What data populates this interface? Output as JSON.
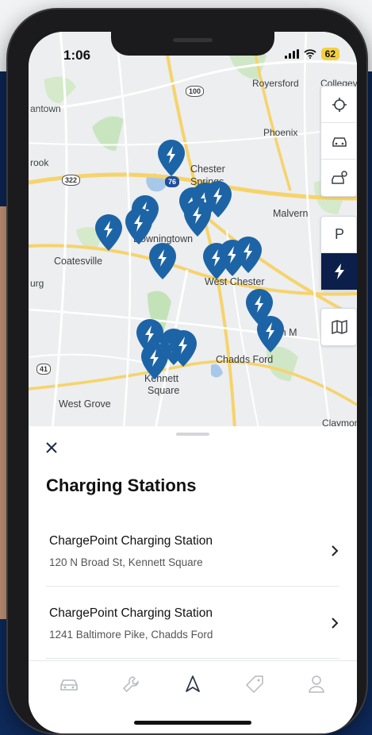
{
  "status_bar": {
    "time": "1:06",
    "battery": "62"
  },
  "map": {
    "labels": {
      "royersford": "Royersford",
      "collegeville": "Collegevi",
      "phoenix": "Phoenix",
      "antown": "antown",
      "rook": "rook",
      "chester": "Chester",
      "springs": "Springs",
      "malvern": "Malvern",
      "downingtown": "Downingtown",
      "coatesville": "Coatesville",
      "urg": "urg",
      "west_chester": "West Chester",
      "len_m": "len M",
      "chadds_ford": "Chadds Ford",
      "kennett": "Kennett",
      "square": "Square",
      "west_grove": "West Grove",
      "claymont": "Claymont"
    },
    "shields": {
      "r100": "100",
      "r322": "322",
      "r76": "76",
      "r41": "41"
    },
    "controls": {
      "locate": "crosshair-icon",
      "vehicle": "car-icon",
      "dealer": "car-service-icon",
      "parking": "P",
      "charging": "lightning-icon",
      "map_style": "map-icon",
      "active": "charging"
    },
    "pin_color": "#1d64a6"
  },
  "sheet": {
    "title": "Charging Stations",
    "stations": [
      {
        "name": "ChargePoint Charging Station",
        "address": "120 N Broad St, Kennett Square"
      },
      {
        "name": "ChargePoint Charging Station",
        "address": "1241 Baltimore Pike, Chadds Ford"
      }
    ]
  },
  "tabbar": {
    "items": [
      "car-icon",
      "wrench-icon",
      "navigation-arrow-icon",
      "tag-icon",
      "profile-icon"
    ],
    "active": "navigation-arrow-icon"
  }
}
